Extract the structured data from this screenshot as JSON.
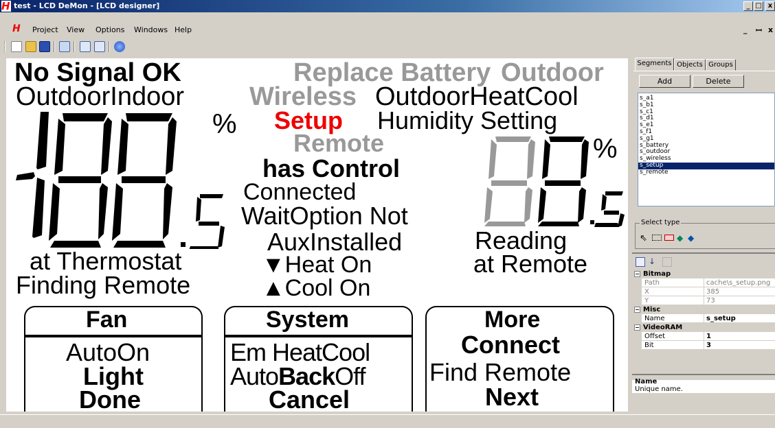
{
  "window": {
    "title": "test - LCD DeMon - [LCD designer]",
    "app_icon_glyph": "H",
    "minimize": "_",
    "maximize": "□",
    "close": "x"
  },
  "menu": {
    "items": [
      "Project",
      "View",
      "Options",
      "Windows",
      "Help"
    ],
    "mdi_minimize": "_",
    "mdi_restore": "ꟷ",
    "mdi_close": "x"
  },
  "toolbar": {
    "buttons": [
      "new-icon",
      "open-icon",
      "save-icon",
      "print-icon",
      "segment-mode-icon",
      "layout-icon",
      "preview-icon"
    ]
  },
  "lcd": {
    "no_signal": "No Signal OK",
    "outdoor_indoor": "OutdoorIndoor",
    "replace_battery": "Replace Battery",
    "outdoor_top": "Outdoor",
    "wireless": "Wireless",
    "outdoor_heat_cool": "OutdoorHeatCool",
    "setup": "Setup",
    "humidity_setting": "Humidity Setting",
    "remote": "Remote",
    "has_control": "has Control",
    "connected": "Connected",
    "wait_option_not": "WaitOption Not",
    "aux_installed": "AuxInstalled",
    "reading": "Reading",
    "at_remote": "at Remote",
    "at_thermostat": "at Thermostat",
    "finding_remote": "Finding Remote",
    "heat_on": "▼Heat On",
    "cool_on": "▲Cool On",
    "left_digits": "188",
    "left_decimal": ".5",
    "left_percent": "%",
    "right_digits": "88",
    "right_decimal": ".5",
    "right_percent": "%",
    "fan_title": "Fan",
    "fan_auto_on": "AutoOn",
    "fan_light": "Light",
    "fan_done": "Done",
    "system_title": "System",
    "system_em_heat_cool": "Em HeatCool",
    "system_auto": "Auto",
    "system_back": "Back",
    "system_off": "Off",
    "system_cancel": "Cancel",
    "more_title": "More",
    "more_connect": "Connect",
    "more_find_remote": "Find Remote",
    "more_next": "Next"
  },
  "panel": {
    "tabs": [
      "Segments",
      "Objects",
      "Groups"
    ],
    "add_label": "Add",
    "delete_label": "Delete",
    "segments": [
      "s_a1",
      "s_b1",
      "s_c1",
      "s_d1",
      "s_e1",
      "s_f1",
      "s_g1",
      "s_battery",
      "s_outdoor",
      "s_wireless",
      "s_setup",
      "s_remote"
    ],
    "selected_segment": "s_setup",
    "select_type_label": "Select type",
    "properties": {
      "bitmap_cat": "Bitmap",
      "path_key": "Path",
      "path_val": "cache\\s_setup.png",
      "x_key": "X",
      "x_val": "385",
      "y_key": "Y",
      "y_val": "73",
      "misc_cat": "Misc",
      "name_key": "Name",
      "name_val": "s_setup",
      "videoram_cat": "VideoRAM",
      "offset_key": "Offset",
      "offset_val": "1",
      "bit_key": "Bit",
      "bit_val": "3"
    },
    "help_title": "Name",
    "help_text": "Unique name."
  }
}
